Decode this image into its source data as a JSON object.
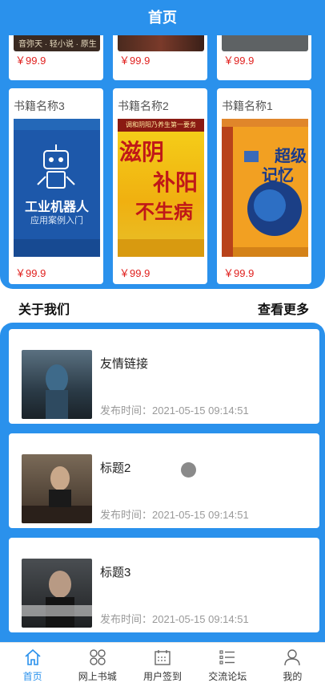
{
  "header": {
    "title": "首页"
  },
  "books_top": [
    {
      "price": "￥99.9",
      "cover_text": "音弥天 · 轻小说 · 原生"
    },
    {
      "price": "￥99.9"
    },
    {
      "price": "￥99.9"
    }
  ],
  "books": [
    {
      "title": "书籍名称3",
      "price": "￥99.9",
      "cover_title": "工业机器人",
      "cover_sub": "应用案例入门"
    },
    {
      "title": "书籍名称2",
      "price": "￥99.9",
      "cover_title1": "滋阴",
      "cover_title2": "补阳",
      "cover_title3": "不生病",
      "cover_top": "调和阴阳乃养生第一要务"
    },
    {
      "title": "书籍名称1",
      "price": "￥99.9",
      "cover_title1": "超级",
      "cover_title2": "记忆术"
    }
  ],
  "section": {
    "left": "关于我们",
    "right": "查看更多"
  },
  "news": [
    {
      "title": "友情链接",
      "time": "发布时间：2021-05-15 09:14:51"
    },
    {
      "title": "标题2",
      "time": "发布时间：2021-05-15 09:14:51"
    },
    {
      "title": "标题3",
      "time": "发布时间：2021-05-15 09:14:51"
    }
  ],
  "tabs": [
    {
      "label": "首页",
      "icon": "home-icon",
      "active": true
    },
    {
      "label": "网上书城",
      "icon": "grid-icon",
      "active": false
    },
    {
      "label": "用户签到",
      "icon": "calendar-icon",
      "active": false
    },
    {
      "label": "交流论坛",
      "icon": "list-icon",
      "active": false
    },
    {
      "label": "我的",
      "icon": "user-icon",
      "active": false
    }
  ],
  "colors": {
    "primary": "#2a91ec",
    "price": "#e0201e"
  }
}
